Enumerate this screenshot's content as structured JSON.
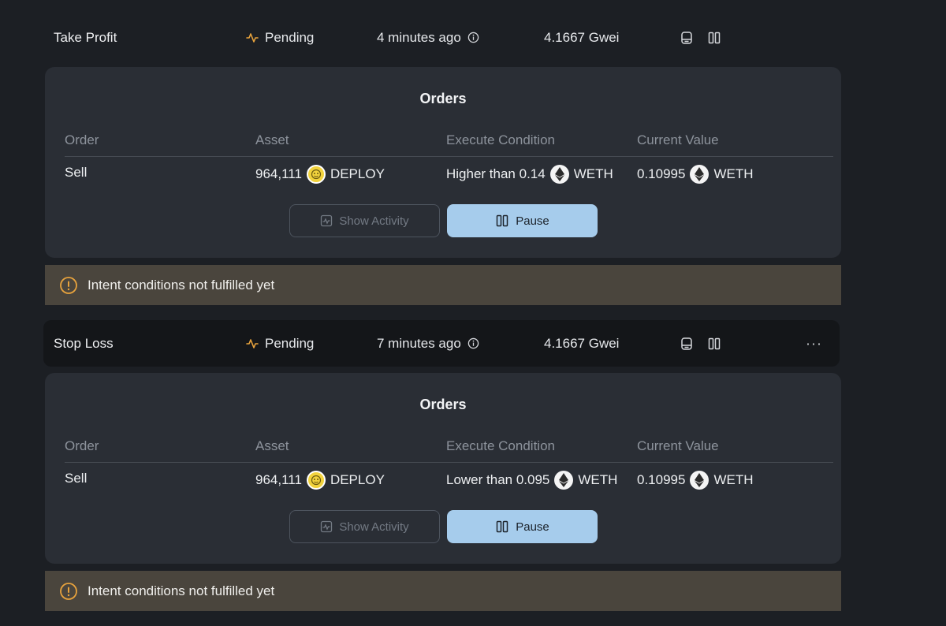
{
  "intents": [
    {
      "type": "Take Profit",
      "status": "Pending",
      "time": "4 minutes ago",
      "gas": "4.1667 Gwei",
      "has_more": false,
      "orders": {
        "title": "Orders",
        "columns": [
          "Order",
          "Asset",
          "Execute Condition",
          "Current Value"
        ],
        "row": {
          "order": "Sell",
          "asset_amount": "964,111",
          "asset_symbol": "DEPLOY",
          "condition_text": "Higher than 0.14",
          "condition_token": "WETH",
          "current_value": "0.10995",
          "current_token": "WETH"
        },
        "show_activity_label": "Show Activity",
        "pause_label": "Pause"
      },
      "warning": "Intent conditions not fulfilled yet"
    },
    {
      "type": "Stop Loss",
      "status": "Pending",
      "time": "7 minutes ago",
      "gas": "4.1667 Gwei",
      "has_more": true,
      "more_label": "···",
      "orders": {
        "title": "Orders",
        "columns": [
          "Order",
          "Asset",
          "Execute Condition",
          "Current Value"
        ],
        "row": {
          "order": "Sell",
          "asset_amount": "964,111",
          "asset_symbol": "DEPLOY",
          "condition_text": "Lower than 0.095",
          "condition_token": "WETH",
          "current_value": "0.10995",
          "current_token": "WETH"
        },
        "show_activity_label": "Show Activity",
        "pause_label": "Pause"
      },
      "warning": "Intent conditions not fulfilled yet"
    }
  ],
  "colors": {
    "status_icon": "#e8a33d",
    "warning_icon": "#e8a33d",
    "pause_button": "#a6ccec"
  },
  "icons": [
    "pulse-icon",
    "info-icon",
    "receipt-icon",
    "pause-icon",
    "activity-icon",
    "warning-icon",
    "deploy-token-icon",
    "eth-icon",
    "more-icon"
  ]
}
